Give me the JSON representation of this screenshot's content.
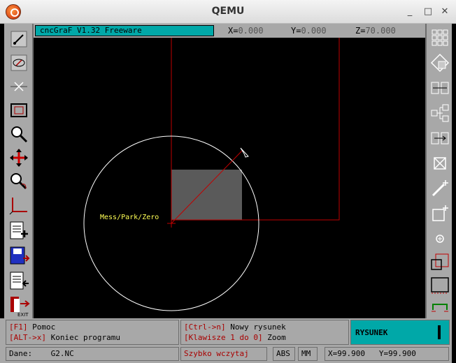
{
  "window": {
    "title": "QEMU",
    "min_label": "_",
    "max_label": "□",
    "close_label": "✕"
  },
  "header": {
    "version": "cncGraF V1.32 Freeware",
    "x_label": "X=",
    "x_value": "0.000",
    "y_label": "Y=",
    "y_value": "0.000",
    "z_label": "Z=",
    "z_value": "70.000"
  },
  "canvas": {
    "marker_label": "Mess/Park/Zero"
  },
  "bottom": {
    "help_key": "[F1]",
    "help_label": " Pomoc",
    "exit_key": "[ALT->x]",
    "exit_label": " Koniec programu",
    "new_key": "[Ctrl->n]",
    "new_label": " Nowy rysunek",
    "zoom_key": "[Klawisze 1 do 0]",
    "zoom_label": " Zoom",
    "mode_label": "RYSUNEK"
  },
  "statusbar": {
    "file_label": "Dane:",
    "file_value": "G2.NC",
    "quick_load": "Szybko wczytaj",
    "abs": "ABS",
    "mm": "MM",
    "x_label": "X=",
    "x_value": "99.900",
    "y_label": "Y=",
    "y_value": "99.900"
  },
  "colors": {
    "toolbar_bg": "#a8a8a8",
    "accent_cyan": "#00a8a8",
    "key_red": "#a80000",
    "drawing_red": "#c00000",
    "circle_white": "#ffffff",
    "rect_gray": "#5a5a5a",
    "label_yellow": "#ffff55"
  },
  "left_tools": [
    "select-pen-icon",
    "select-ellipse-icon",
    "scissors-icon",
    "rectangle-select-icon",
    "zoom-icon",
    "move-arrows-icon",
    "zoom-hand-icon",
    "axis-origin-icon",
    "save-add-icon",
    "save-icon",
    "load-icon",
    "exit-icon"
  ],
  "right_tools": [
    "grid-icon",
    "rotate-icon",
    "align-horizontal-icon",
    "node-connect-icon",
    "align-icon",
    "delete-box-icon",
    "magic-wand-icon",
    "add-box-icon",
    "center-point-icon",
    "offset-box-icon",
    "dashed-box-icon",
    "bracket-icon"
  ]
}
